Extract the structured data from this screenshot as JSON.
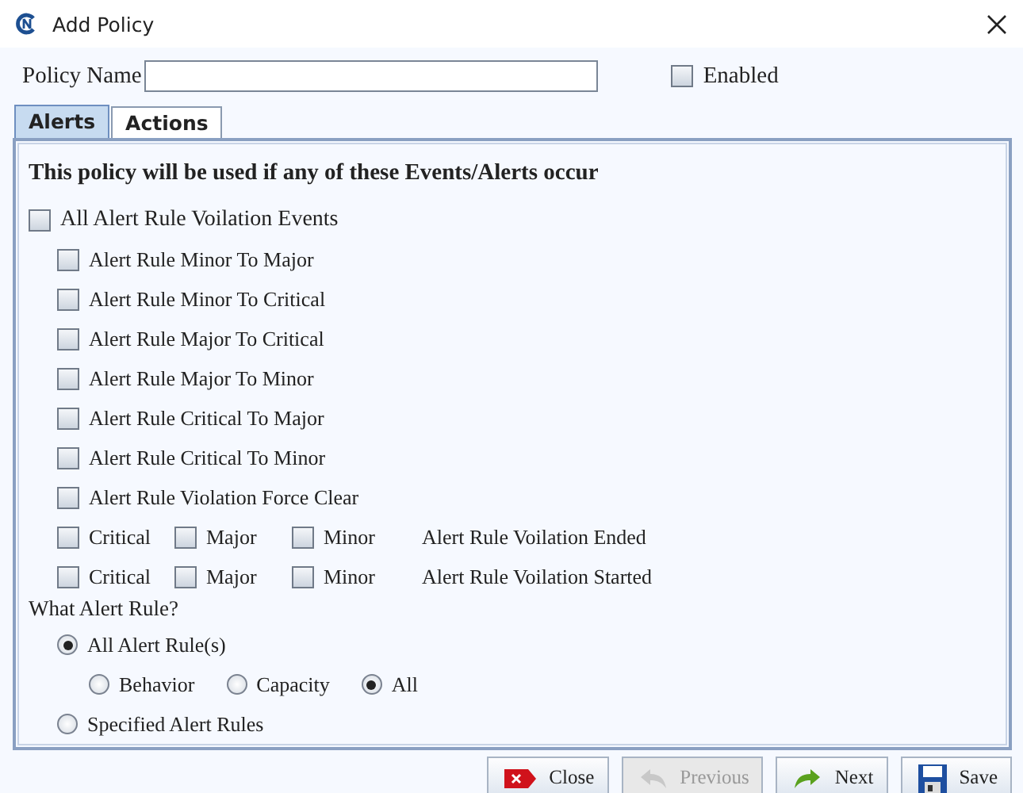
{
  "window": {
    "title": "Add Policy"
  },
  "policy_name": {
    "label": "Policy Name"
  },
  "enabled": {
    "label": "Enabled",
    "checked": false
  },
  "tabs": [
    {
      "label": "Alerts",
      "selected": true
    },
    {
      "label": "Actions",
      "selected": false
    }
  ],
  "heading": "This policy will be used if any of these Events/Alerts occur",
  "events": {
    "label": "All Alert Rule Voilation Events",
    "checked": false,
    "children": [
      {
        "label": "Alert Rule Minor To Major",
        "checked": false
      },
      {
        "label": "Alert Rule Minor To Critical",
        "checked": false
      },
      {
        "label": "Alert Rule Major To Critical",
        "checked": false
      },
      {
        "label": "Alert Rule Major To Minor",
        "checked": false
      },
      {
        "label": "Alert Rule Critical To Major",
        "checked": false
      },
      {
        "label": "Alert Rule Critical To Minor",
        "checked": false
      },
      {
        "label": "Alert Rule Violation Force Clear",
        "checked": false
      }
    ]
  },
  "severity_rows": [
    {
      "options": [
        {
          "label": "Critical",
          "checked": false
        },
        {
          "label": "Major",
          "checked": false
        },
        {
          "label": "Minor",
          "checked": false
        }
      ],
      "label": "Alert Rule Voilation Ended"
    },
    {
      "options": [
        {
          "label": "Critical",
          "checked": false
        },
        {
          "label": "Major",
          "checked": false
        },
        {
          "label": "Minor",
          "checked": false
        }
      ],
      "label": "Alert Rule Voilation Started"
    }
  ],
  "rule_question": "What Alert Rule?",
  "rule_options": [
    {
      "label": "All Alert Rule(s)",
      "selected": true,
      "children": [
        {
          "label": "Behavior",
          "selected": false
        },
        {
          "label": "Capacity",
          "selected": false
        },
        {
          "label": "All",
          "selected": true
        }
      ]
    },
    {
      "label": "Specified Alert Rules",
      "selected": false
    }
  ],
  "buttons": [
    {
      "label": "Close",
      "kind": "close",
      "disabled": false
    },
    {
      "label": "Previous",
      "kind": "previous",
      "disabled": true
    },
    {
      "label": "Next",
      "kind": "next",
      "disabled": false
    },
    {
      "label": "Save",
      "kind": "save",
      "disabled": false
    }
  ]
}
